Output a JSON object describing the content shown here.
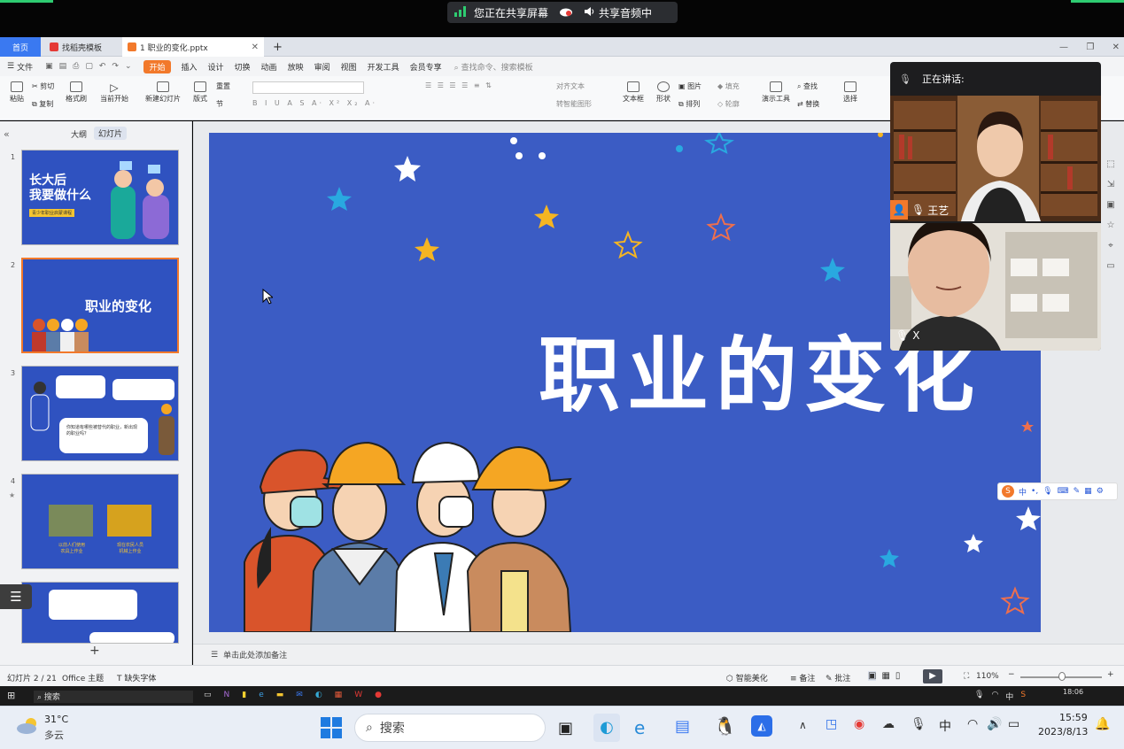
{
  "share_bar": {
    "sharing_label": "您正在共享屏幕",
    "audio_label": "共享音频中"
  },
  "tabs": {
    "home": "首页",
    "template": "找稻壳模板",
    "doc": "1 职业的变化.pptx",
    "add": "+"
  },
  "menu": {
    "file": "文件",
    "items": [
      "开始",
      "插入",
      "设计",
      "切换",
      "动画",
      "放映",
      "审阅",
      "视图",
      "开发工具",
      "会员专享"
    ],
    "search": "查找命令、搜索模板"
  },
  "ribbon": {
    "paste": "粘贴",
    "cut": "剪切",
    "copy": "复制",
    "format": "格式刷",
    "from_current": "当前开始",
    "new_slide": "新建幻灯片",
    "layout": "版式",
    "section": "节",
    "reset": "重置",
    "textbox": "文本框",
    "shape": "形状",
    "picture": "图片",
    "arrange": "排列",
    "fill": "填充",
    "outline": "轮廓",
    "present_tool": "演示工具",
    "find": "查找",
    "replace": "替换",
    "select": "选择",
    "align_text": "对齐文本",
    "smart_shape": "转智能图形"
  },
  "left_panel": {
    "outline_tab": "大纲",
    "slides_tab": "幻灯片",
    "slide_numbers": [
      "1",
      "2",
      "3",
      "4",
      "5"
    ],
    "slide1_title_line1": "长大后",
    "slide1_title_line2": "我要做什么",
    "slide1_sub": "青少年职业启蒙课程",
    "slide2_title": "职业的变化",
    "slide4_cap1": "以前人们使用\n农具上作业",
    "slide4_cap2": "现在农民人员\n机械上作业",
    "slide3_q": "你知道有哪些被替代的职业，新出现的职业吗？",
    "add": "+"
  },
  "slide": {
    "title": "职业的变化"
  },
  "notes": {
    "placeholder": "单击此处添加备注"
  },
  "status": {
    "slide_count": "幻灯片 2 / 21",
    "theme": "Office 主题",
    "missing_font": "缺失字体",
    "beautify": "智能美化",
    "notes": "备注",
    "comments": "批注",
    "zoom": "110%"
  },
  "taskbar_inner": {
    "search": "搜索",
    "time": "18:06",
    "ime": "中"
  },
  "video": {
    "speaking_label": "正在讲话:",
    "participant1": "王艺",
    "participant2": "X"
  },
  "ime_bar": {
    "label": "中"
  },
  "taskbar": {
    "temp": "31°C",
    "weather": "多云",
    "search": "搜索",
    "ime": "中",
    "time": "15:59",
    "date": "2023/8/13"
  },
  "colors": {
    "slide_bg": "#3b5cc4",
    "accent": "#f2792b",
    "share_green": "#2ecc71"
  }
}
